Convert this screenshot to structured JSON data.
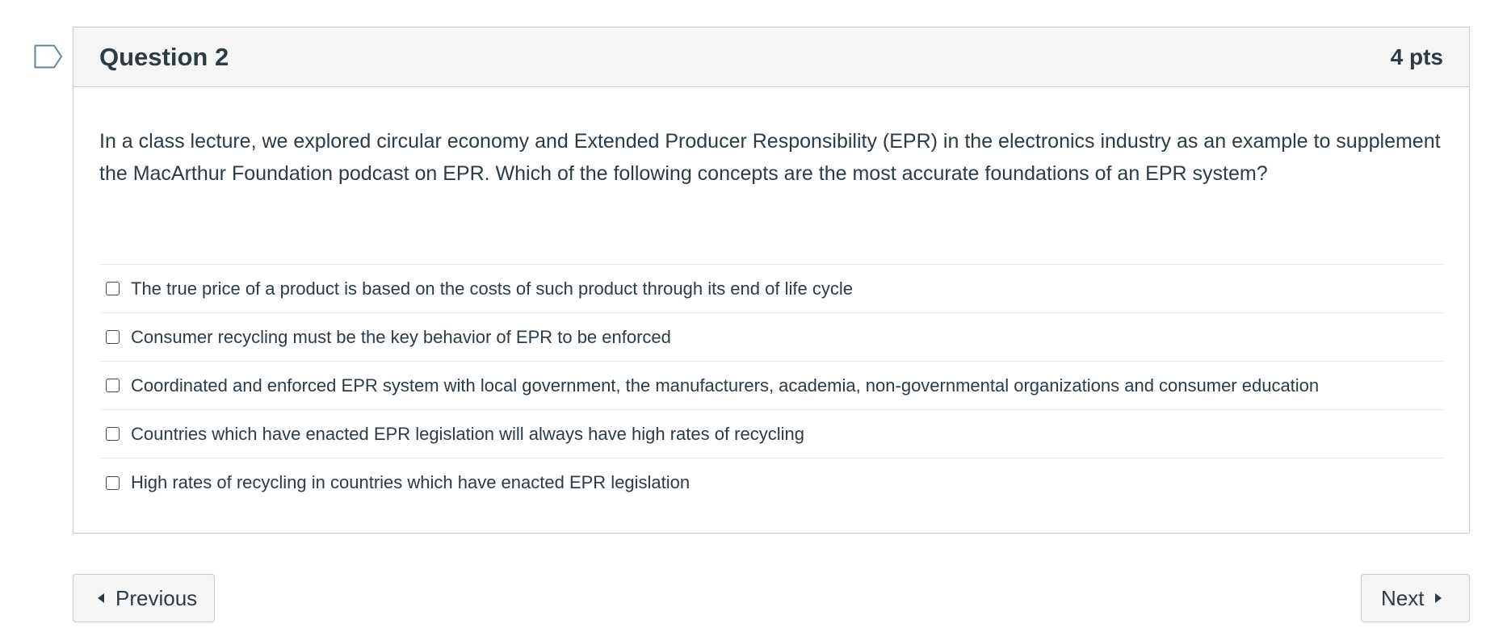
{
  "question": {
    "title": "Question 2",
    "points": "4 pts",
    "text": "In a class lecture, we explored circular economy and Extended Producer Responsibility (EPR) in the electronics industry as an example to supplement the MacArthur Foundation podcast on EPR. Which of the following concepts are the most accurate foundations of an EPR system?",
    "flag_icon": "bookmark-flag-icon",
    "answers": [
      {
        "label": "The true price of a product is based on the costs of such product through its end of life cycle",
        "checked": false
      },
      {
        "label": "Consumer recycling must be the key behavior of EPR to be enforced",
        "checked": false
      },
      {
        "label": "Coordinated and enforced EPR system with local government, the manufacturers, academia, non-governmental organizations and consumer education",
        "checked": false
      },
      {
        "label": "Countries which have enacted EPR legislation will always have high rates of recycling",
        "checked": false
      },
      {
        "label": "High rates of recycling in countries which have enacted EPR legislation",
        "checked": false
      }
    ]
  },
  "navigation": {
    "previous_label": "Previous",
    "next_label": "Next"
  },
  "colors": {
    "text": "#2d3b45",
    "header_bg": "#f5f5f5",
    "border": "#c7cdd1",
    "divider": "#e4e7ea",
    "flag_stroke": "#66839a"
  }
}
